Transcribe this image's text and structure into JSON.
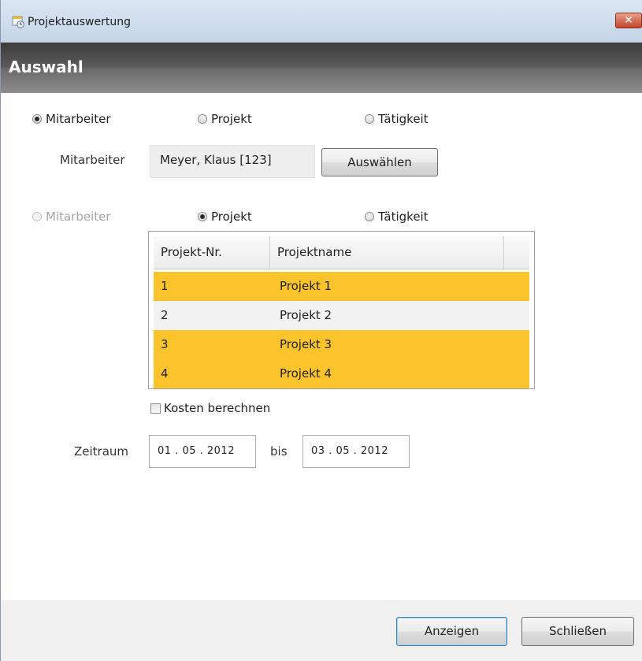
{
  "window": {
    "title": "Projektauswertung",
    "close_glyph": "✕"
  },
  "header": {
    "title": "Auswahl"
  },
  "selection1": {
    "options": [
      "Mitarbeiter",
      "Projekt",
      "Tätigkeit"
    ],
    "selected": "Mitarbeiter"
  },
  "employee": {
    "label": "Mitarbeiter",
    "value": "Meyer, Klaus [123]",
    "select_button": "Auswählen"
  },
  "selection2": {
    "options": [
      "Mitarbeiter",
      "Projekt",
      "Tätigkeit"
    ],
    "selected": "Projekt",
    "disabled": [
      "Mitarbeiter"
    ]
  },
  "projects_table": {
    "columns": [
      "Projekt-Nr.",
      "Projektname"
    ],
    "rows": [
      {
        "nr": "1",
        "name": "Projekt 1",
        "selected": true
      },
      {
        "nr": "2",
        "name": "Projekt 2",
        "selected": false
      },
      {
        "nr": "3",
        "name": "Projekt 3",
        "selected": true
      },
      {
        "nr": "4",
        "name": "Projekt 4",
        "selected": true
      }
    ],
    "selection_color": "#fbc32c"
  },
  "costs": {
    "label": "Kosten berechnen",
    "checked": false
  },
  "period": {
    "label": "Zeitraum",
    "from": "01 . 05 . 2012",
    "separator": "bis",
    "to": "03 . 05 . 2012"
  },
  "footer": {
    "show_button": "Anzeigen",
    "close_button": "Schließen"
  }
}
